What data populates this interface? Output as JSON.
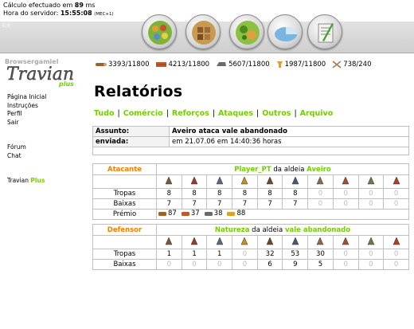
{
  "status": {
    "calc_prefix": "Cálculo efectuado em",
    "calc_value": "89",
    "calc_unit": "ms",
    "server_label": "Hora do servidor:",
    "server_time": "15:55:08",
    "server_tz": "(MEC+1)"
  },
  "version": "E:0",
  "nav_icons": [
    "village-overview-icon",
    "village-center-icon",
    "map-icon",
    "statistics-icon",
    "messages-icon"
  ],
  "logo": {
    "top_text": "Browsergamiel",
    "main": "Travian",
    "plus": "plus"
  },
  "sidebar": {
    "items": [
      "Página Inicial",
      "Instruções",
      "Perfil",
      "Sair"
    ],
    "items2": [
      "Fórum",
      "Chat"
    ],
    "plus_label": "Travian",
    "plus_word": "Plus"
  },
  "resources": [
    {
      "icon": "wood-icon",
      "text": "3393/11800"
    },
    {
      "icon": "clay-icon",
      "text": "4213/11800"
    },
    {
      "icon": "iron-icon",
      "text": "5607/11800"
    },
    {
      "icon": "crop-icon",
      "text": "1987/11800"
    },
    {
      "icon": "crop-consumption-icon",
      "text": "738/240"
    }
  ],
  "page_title": "Relatórios",
  "tabs": [
    "Tudo",
    "Comércio",
    "Reforços",
    "Ataques",
    "Outros",
    "Arquivo"
  ],
  "report": {
    "subject_label": "Assunto:",
    "subject_value": "Aveiro ataca vale abandonado",
    "sent_label": "enviada:",
    "sent_value": "em 21.07.06 em 14:40:36 horas"
  },
  "attacker": {
    "role": "Atacante",
    "player": "Player_PT",
    "middle": "da aldeia",
    "village": "Aveiro",
    "unit_icons": [
      "legionnaire-icon",
      "praetorian-icon",
      "imperian-icon",
      "equites-legati-icon",
      "equites-imperatoris-icon",
      "equites-caesaris-icon",
      "battering-ram-icon",
      "fire-catapult-icon",
      "senator-icon",
      "settler-icon"
    ],
    "troops_label": "Tropas",
    "troops": [
      "8",
      "8",
      "8",
      "8",
      "8",
      "8",
      "0",
      "0",
      "0",
      "0"
    ],
    "losses_label": "Baixas",
    "losses": [
      "7",
      "7",
      "7",
      "7",
      "7",
      "7",
      "0",
      "0",
      "0",
      "0"
    ],
    "bounty_label": "Prémio",
    "bounty": [
      {
        "icon": "wood-icon",
        "value": "87"
      },
      {
        "icon": "clay-icon",
        "value": "37"
      },
      {
        "icon": "iron-icon",
        "value": "38"
      },
      {
        "icon": "crop-icon",
        "value": "88"
      }
    ]
  },
  "defender": {
    "role": "Defensor",
    "player": "Natureza",
    "middle": "da aldeia",
    "village": "vale abandonado",
    "unit_icons": [
      "rat-icon",
      "spider-icon",
      "snake-icon",
      "bat-icon",
      "wild-boar-icon",
      "wolf-icon",
      "bear-icon",
      "crocodile-icon",
      "tiger-icon",
      "elephant-icon"
    ],
    "troops_label": "Tropas",
    "troops": [
      "1",
      "1",
      "1",
      "0",
      "32",
      "53",
      "30",
      "0",
      "0",
      "0"
    ],
    "losses_label": "Baixas",
    "losses": [
      "0",
      "0",
      "0",
      "0",
      "6",
      "9",
      "5",
      "0",
      "0",
      "0"
    ]
  },
  "colors": {
    "link_green": "#71d000",
    "orange": "#ff7e00",
    "zero_grey": "#bbbbbb"
  }
}
